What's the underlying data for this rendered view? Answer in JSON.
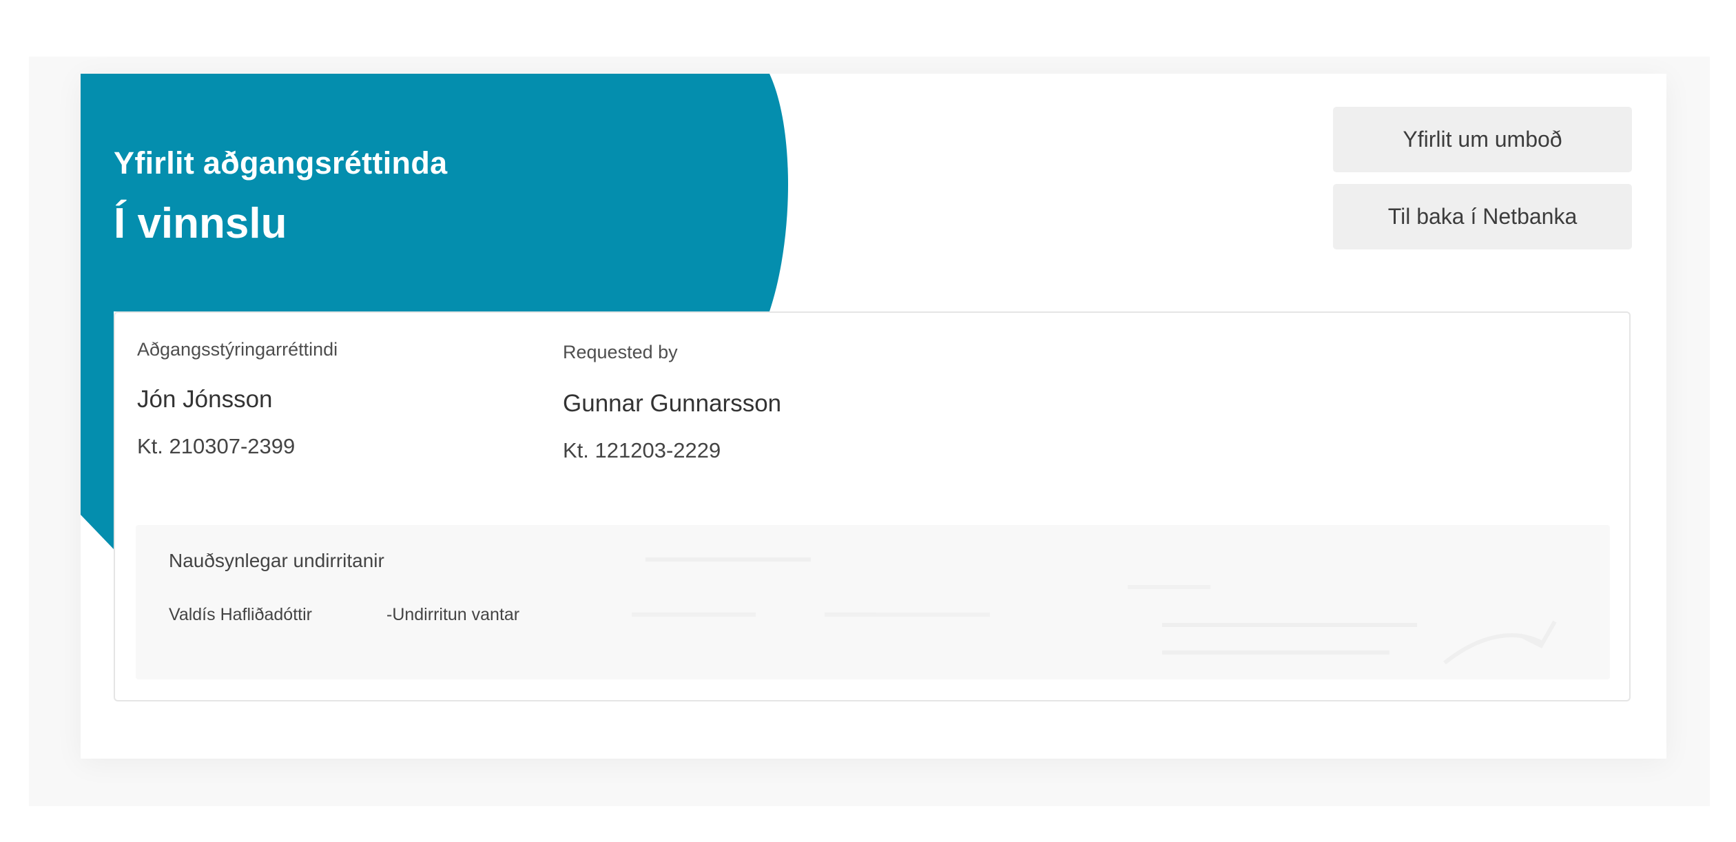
{
  "header": {
    "subtitle": "Yfirlit aðgangsréttinda",
    "title": "Í vinnslu"
  },
  "buttons": {
    "overview_label": "Yfirlit um umboð",
    "back_label": "Til baka í Netbanka"
  },
  "parties": [
    {
      "label": "Aðgangsstýringarréttindi",
      "name": "Jón  Jónsson",
      "kt": "Kt. 210307-2399"
    },
    {
      "label": "Requested by",
      "name": "Gunnar Gunnarsson",
      "kt": "Kt. 121203-2229"
    }
  ],
  "signatures": {
    "title": "Nauðsynlegar undirritanir",
    "rows": [
      {
        "name": "Valdís Hafliðadóttir",
        "status": "-Undirritun vantar"
      }
    ]
  },
  "colors": {
    "accent": "#048eae",
    "button_bg": "#efefef",
    "panel_bg": "#f8f8f8"
  }
}
